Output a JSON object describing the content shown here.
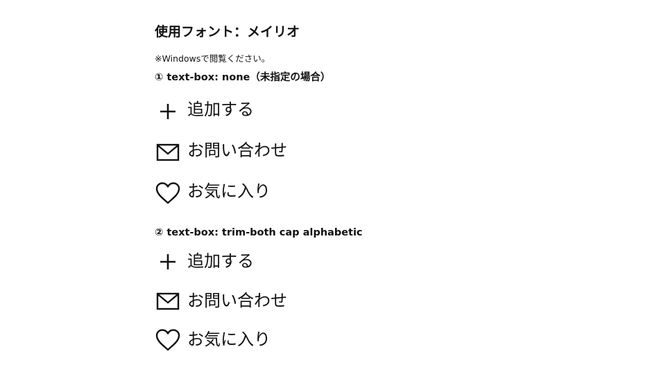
{
  "page": {
    "title": "使用フォント：メイリオ",
    "note": "※Windowsで閲覧ください。"
  },
  "sections": [
    {
      "heading": "① text-box: none（未指定の場合）",
      "items": [
        {
          "icon": "plus-icon",
          "label": "追加する"
        },
        {
          "icon": "mail-icon",
          "label": "お問い合わせ"
        },
        {
          "icon": "heart-icon",
          "label": "お気に入り"
        }
      ]
    },
    {
      "heading": "② text-box: trim-both cap alphabetic",
      "items": [
        {
          "icon": "plus-icon",
          "label": "追加する"
        },
        {
          "icon": "mail-icon",
          "label": "お問い合わせ"
        },
        {
          "icon": "heart-icon",
          "label": "お気に入り"
        }
      ]
    }
  ]
}
